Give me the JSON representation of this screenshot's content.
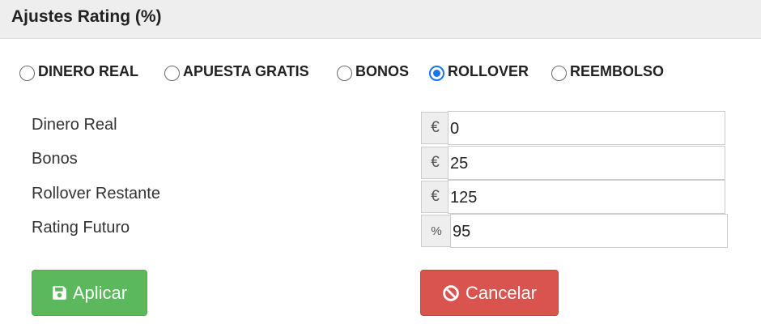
{
  "header": {
    "title": "Ajustes Rating (%)"
  },
  "mode": {
    "options": [
      {
        "label": "DINERO REAL",
        "checked": false
      },
      {
        "label": "APUESTA GRATIS",
        "checked": false
      },
      {
        "label": "BONOS",
        "checked": false
      },
      {
        "label": "ROLLOVER",
        "checked": true
      },
      {
        "label": "REEMBOLSO",
        "checked": false
      }
    ]
  },
  "fields": [
    {
      "label": "Dinero Real",
      "addon": "€",
      "value": "0"
    },
    {
      "label": "Bonos",
      "addon": "€",
      "value": "25"
    },
    {
      "label": "Rollover Restante",
      "addon": "€",
      "value": "125"
    },
    {
      "label": "Rating Futuro",
      "addon": "%",
      "value": "95"
    }
  ],
  "actions": {
    "apply_label": "Aplicar",
    "cancel_label": "Cancelar",
    "apply_icon": "save-icon",
    "cancel_icon": "ban-icon"
  },
  "colors": {
    "apply": "#5cb85c",
    "cancel": "#d9534f",
    "radio_selected": "#1a73e8"
  }
}
